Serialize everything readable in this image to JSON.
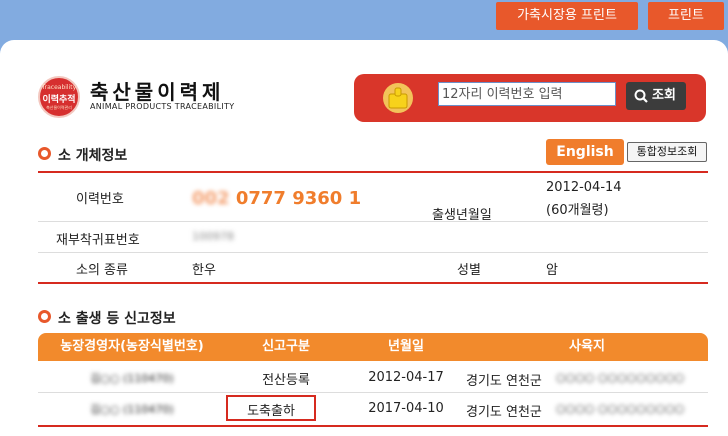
{
  "top_buttons": {
    "livestock_print": "가축시장용 프린트",
    "print": "프린트"
  },
  "logo": {
    "badge_top": "Traceability",
    "badge_main": "이력추적",
    "badge_bottom": "축산물이력관리",
    "title": "축산물이력제",
    "subtitle": "ANIMAL PRODUCTS TRACEABILITY"
  },
  "search": {
    "placeholder": "12자리 이력번호 입력",
    "button": "조회"
  },
  "cattle_info": {
    "section_title": "소 개체정보",
    "english_button": "English",
    "integrated_button": "통합정보조회",
    "trace_label": "이력번호",
    "trace_prefix": "002",
    "trace_number": "0777 9360 1",
    "birth_label": "출생년월일",
    "birth_date": "2012-04-14",
    "birth_age": "(60개월령)",
    "ear_tag_label": "재부착귀표번호",
    "ear_tag_value": "100978",
    "species_label": "소의 종류",
    "species_value": "한우",
    "sex_label": "성별",
    "sex_value": "암"
  },
  "report_info": {
    "section_title": "소 출생 등 신고정보",
    "columns": [
      "농장경영자(농장식별번호)",
      "신고구분",
      "년월일",
      "사육지"
    ],
    "rows": [
      {
        "owner": "김○○ (110470)",
        "type": "전산등록",
        "date": "2012-04-17",
        "location": "경기도 연천군",
        "location_detail": "○○○○ ○○○○○○○○○"
      },
      {
        "owner": "김○○ (110470)",
        "type": "도축출하",
        "date": "2017-04-10",
        "location": "경기도 연천군",
        "location_detail": "○○○○ ○○○○○○○○○"
      }
    ]
  },
  "colors": {
    "accent_orange": "#f07d2c",
    "accent_red": "#d62a1f",
    "page_bg": "#82abe0"
  }
}
